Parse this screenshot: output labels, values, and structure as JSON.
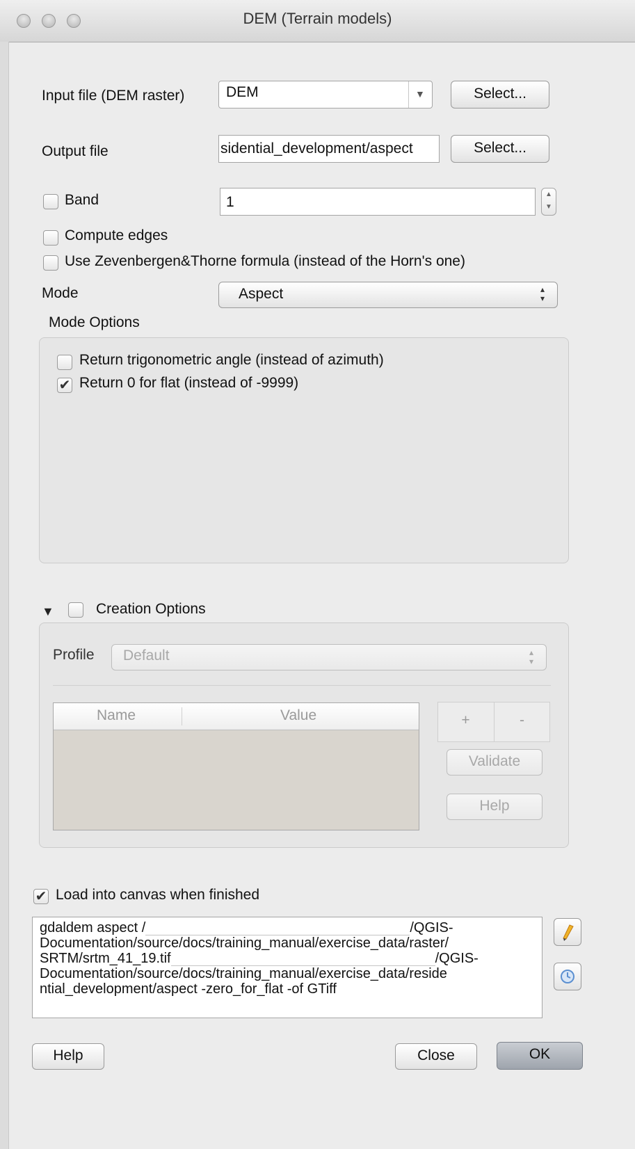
{
  "window": {
    "title": "DEM (Terrain models)"
  },
  "input_file": {
    "label": "Input file (DEM raster)",
    "value": "DEM",
    "select_label": "Select..."
  },
  "output_file": {
    "label": "Output file",
    "value": "sidential_development/aspect",
    "select_label": "Select..."
  },
  "band": {
    "label": "Band",
    "checked": false,
    "value": "1"
  },
  "compute_edges": {
    "label": "Compute edges",
    "checked": false
  },
  "zevenbergen": {
    "label": "Use Zevenbergen&Thorne formula (instead of the Horn's one)",
    "checked": false
  },
  "mode": {
    "label": "Mode",
    "value": "Aspect"
  },
  "mode_options": {
    "title": "Mode Options",
    "trig": {
      "label": "Return trigonometric angle (instead of azimuth)",
      "checked": false
    },
    "zero_flat": {
      "label": "Return 0 for flat (instead of -9999)",
      "checked": true
    }
  },
  "creation_options": {
    "label": "Creation Options",
    "checked": false,
    "profile_label": "Profile",
    "profile_value": "Default",
    "table_headers": [
      "Name",
      "Value"
    ],
    "add_label": "+",
    "remove_label": "-",
    "validate_label": "Validate",
    "help_label": "Help"
  },
  "load_canvas": {
    "label": "Load into canvas when finished",
    "checked": true
  },
  "command": {
    "line1_a": "gdaldem aspect /",
    "line1_b": "/QGIS-",
    "line2": "Documentation/source/docs/training_manual/exercise_data/raster/",
    "line3_a": "SRTM/srtm_41_19.tif",
    "line3_b": "/QGIS-",
    "line4": "Documentation/source/docs/training_manual/exercise_data/reside",
    "line5": "ntial_development/aspect -zero_for_flat -of GTiff"
  },
  "buttons": {
    "help": "Help",
    "close": "Close",
    "ok": "OK"
  },
  "icons": {
    "edit": "pencil-icon",
    "reset": "reset-icon"
  }
}
